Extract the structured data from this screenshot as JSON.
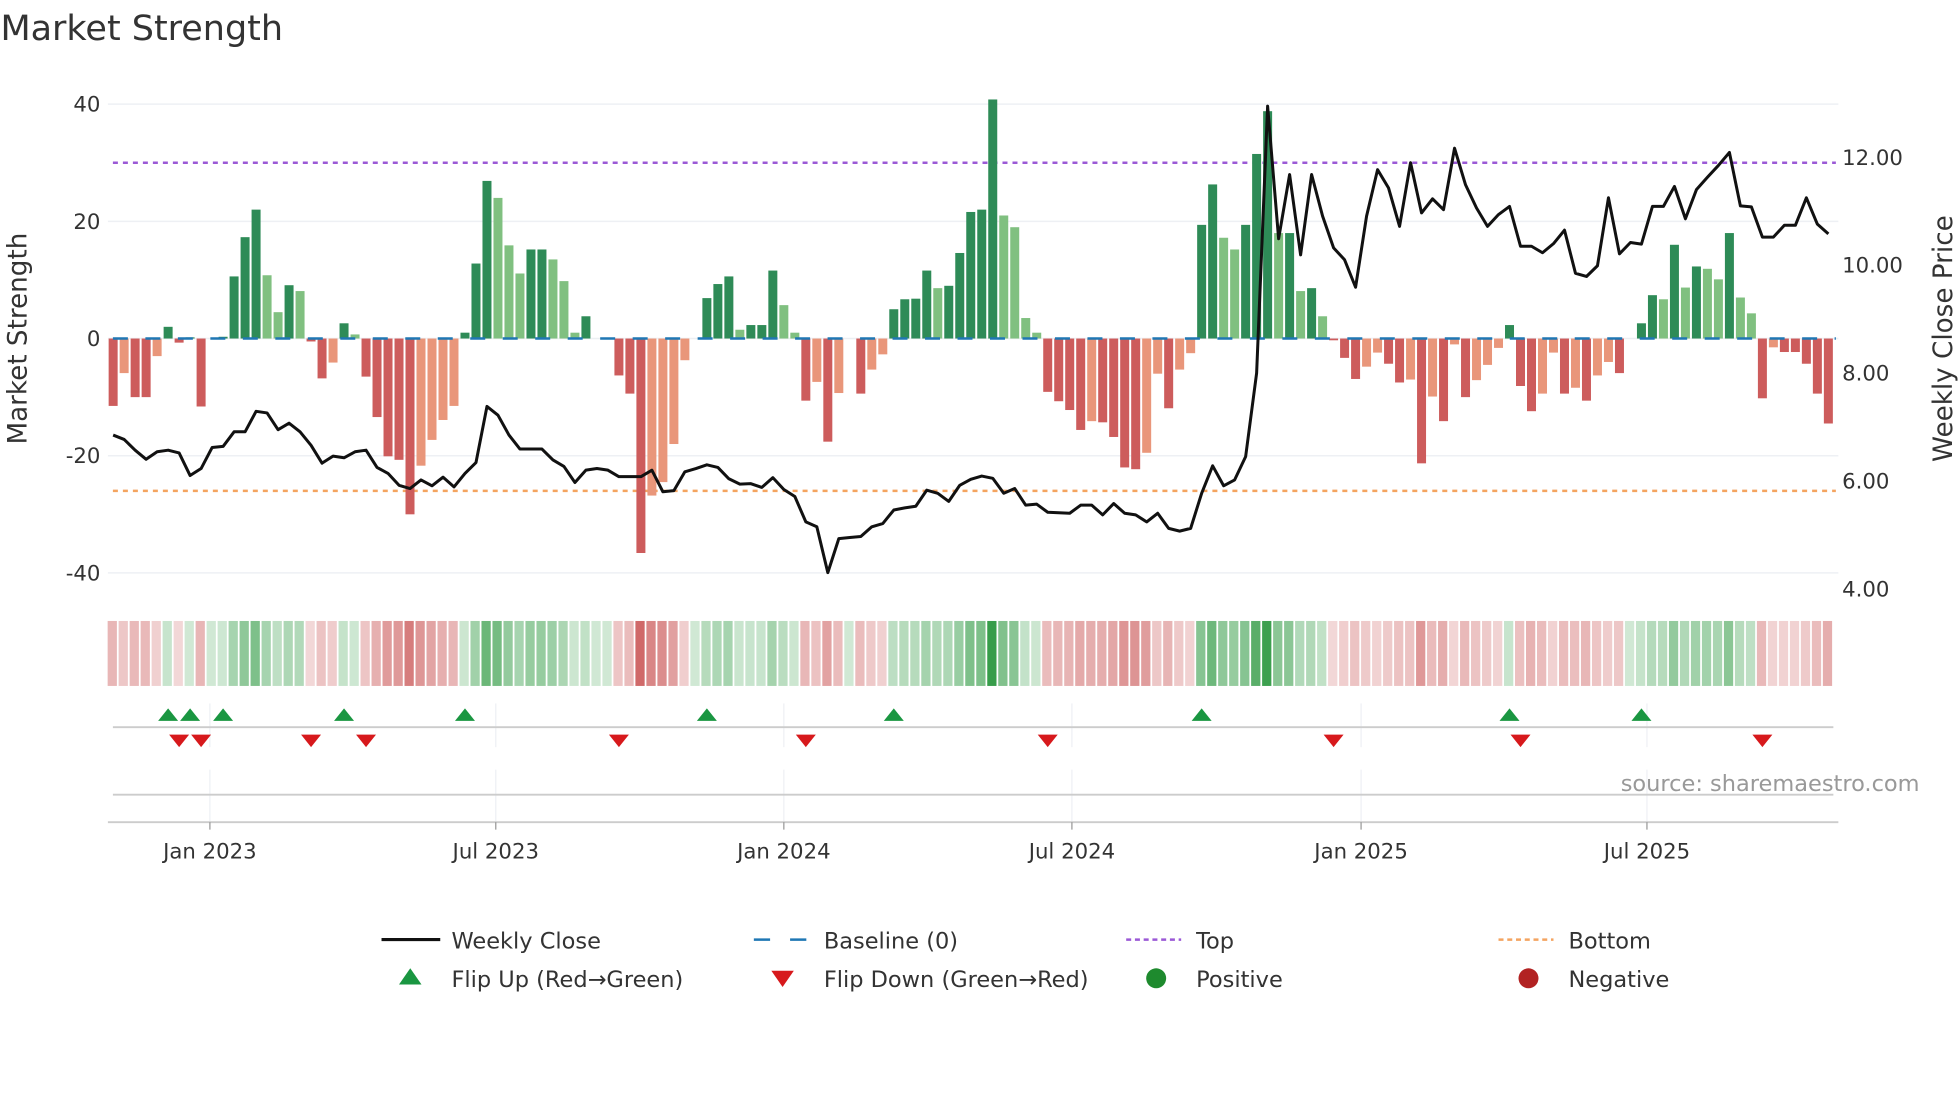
{
  "chart_data": {
    "type": "bar+line",
    "title": "Market Strength",
    "ylabel": "Market Strength",
    "ylabel_right": "Weekly Close Price",
    "ylim": [
      -44,
      44
    ],
    "ylim_right": [
      3.86,
      13.42
    ],
    "yticks": [
      40,
      20,
      0,
      -20,
      -40
    ],
    "yticks_right": [
      "12.00",
      "10.00",
      "8.00",
      "6.00",
      "4.00"
    ],
    "xticks": [
      {
        "label": "Jan 2023",
        "week": 8.8
      },
      {
        "label": "Jul 2023",
        "week": 34.8
      },
      {
        "label": "Jan 2024",
        "week": 61
      },
      {
        "label": "Jul 2024",
        "week": 87.2
      },
      {
        "label": "Jan 2025",
        "week": 113.5
      },
      {
        "label": "Jul 2025",
        "week": 139.5
      }
    ],
    "top_threshold": 30,
    "bottom_threshold": -26,
    "baseline": 0,
    "strength": [
      -11.5,
      -5.9,
      -10,
      -10,
      -3,
      2,
      -0.7,
      0.2,
      -11.6,
      0,
      0.3,
      10.6,
      17.3,
      22,
      10.8,
      4.5,
      9.1,
      8.1,
      -0.5,
      -6.8,
      -4.1,
      2.6,
      0.7,
      -6.5,
      -13.4,
      -20.1,
      -20.7,
      -30,
      -21.7,
      -17.3,
      -13.9,
      -11.5,
      1,
      12.8,
      26.9,
      24,
      15.9,
      11.1,
      15.2,
      15.2,
      13.5,
      9.8,
      1,
      3.8,
      0,
      0,
      -6.3,
      -9.4,
      -36.6,
      -26.8,
      -24.5,
      -18,
      -3.7,
      0,
      6.9,
      9.3,
      10.6,
      1.5,
      2.3,
      2.3,
      11.6,
      5.7,
      1,
      -10.6,
      -7.4,
      -17.6,
      -9.3,
      0,
      -9.4,
      -5.3,
      -2.7,
      5,
      6.7,
      6.8,
      11.6,
      8.6,
      9,
      14.6,
      21.6,
      22,
      40.8,
      21,
      19,
      3.5,
      1,
      -9.1,
      -10.7,
      -12.2,
      -15.6,
      -14.1,
      -14.3,
      -16.8,
      -22,
      -22.3,
      -19.5,
      -6,
      -11.9,
      -5.3,
      -2.5,
      19.4,
      26.3,
      17.2,
      15.2,
      19.4,
      31.5,
      38.8,
      18,
      18,
      8.1,
      8.6,
      3.8,
      -0.3,
      -3.3,
      -6.9,
      -4.8,
      -2.4,
      -4.3,
      -7.5,
      -7,
      -21.3,
      -9.9,
      -14.1,
      -1,
      -10,
      -7.1,
      -4.5,
      -1.6,
      2.3,
      -8.1,
      -12.4,
      -9.4,
      -2.4,
      -9.4,
      -8.4,
      -10.6,
      -6.3,
      -4,
      -5.9,
      0,
      2.6,
      7.4,
      6.7,
      16,
      8.7,
      12.3,
      11.9,
      10.1,
      18,
      7,
      4.3,
      -10.2,
      -1.5,
      -2.3,
      -2.3,
      -4.3,
      -9.4,
      -14.5
    ],
    "weekly_close": [
      6.85,
      6.77,
      6.57,
      6.4,
      6.54,
      6.57,
      6.52,
      6.1,
      6.23,
      6.62,
      6.64,
      6.91,
      6.91,
      7.29,
      7.26,
      6.95,
      7.07,
      6.91,
      6.66,
      6.33,
      6.46,
      6.43,
      6.54,
      6.57,
      6.25,
      6.14,
      5.92,
      5.86,
      6.02,
      5.91,
      6.07,
      5.89,
      6.14,
      6.34,
      7.38,
      7.22,
      6.85,
      6.59,
      6.59,
      6.59,
      6.39,
      6.27,
      5.97,
      6.2,
      6.23,
      6.2,
      6.08,
      6.08,
      6.08,
      6.2,
      5.8,
      5.82,
      6.17,
      6.23,
      6.3,
      6.25,
      6.04,
      5.94,
      5.95,
      5.88,
      6.06,
      5.84,
      5.71,
      5.24,
      5.15,
      4.3,
      4.93,
      4.95,
      4.97,
      5.15,
      5.21,
      5.46,
      5.5,
      5.53,
      5.83,
      5.77,
      5.62,
      5.92,
      6.03,
      6.09,
      6.05,
      5.77,
      5.86,
      5.55,
      5.57,
      5.42,
      5.41,
      5.4,
      5.55,
      5.55,
      5.37,
      5.58,
      5.4,
      5.37,
      5.24,
      5.4,
      5.12,
      5.07,
      5.12,
      5.77,
      6.28,
      5.91,
      6.02,
      6.45,
      8.0,
      12.95,
      10.49,
      11.68,
      10.19,
      11.68,
      10.91,
      10.32,
      10.1,
      9.59,
      10.91,
      11.77,
      11.43,
      10.72,
      11.9,
      10.97,
      11.23,
      11.03,
      12.17,
      11.49,
      11.06,
      10.72,
      10.94,
      11.09,
      10.35,
      10.35,
      10.23,
      10.4,
      10.65,
      9.85,
      9.79,
      9.99,
      11.25,
      10.21,
      10.42,
      10.39,
      11.09,
      11.09,
      11.46,
      10.86,
      11.4,
      11.63,
      11.85,
      12.09,
      11.1,
      11.08,
      10.52,
      10.52,
      10.74,
      10.74,
      11.25,
      10.76,
      10.58
    ],
    "flip_up_weeks": [
      5,
      7,
      10,
      21,
      32,
      54,
      71,
      99,
      127,
      139
    ],
    "flip_down_weeks": [
      6,
      8,
      18,
      23,
      46,
      63,
      85,
      111,
      128,
      150
    ],
    "legend": {
      "placement": "bottom",
      "items": [
        {
          "label": "Weekly Close",
          "kind": "line"
        },
        {
          "label": "Baseline (0)",
          "kind": "baseline"
        },
        {
          "label": "Top",
          "kind": "top"
        },
        {
          "label": "Bottom",
          "kind": "bottom"
        },
        {
          "label": "Flip Up (Red→Green)",
          "kind": "flip-up"
        },
        {
          "label": "Flip Down (Green→Red)",
          "kind": "flip-down"
        },
        {
          "label": "Positive",
          "kind": "positive"
        },
        {
          "label": "Negative",
          "kind": "negative"
        }
      ]
    },
    "source": "source: sharemaestro.com"
  },
  "colors": {
    "rising_positive": "#2e8b57",
    "falling_positive": "#80c080",
    "falling_negative": "#cd5c5c",
    "rising_negative": "#e9967a",
    "line": "#111111",
    "baseline": "#1f77b4",
    "top": "#9b59d6",
    "bottom": "#f4a460",
    "flip_up": "#1a9641",
    "flip_down": "#d7191c",
    "positive": "#1e8a2e",
    "negative": "#b22222"
  }
}
